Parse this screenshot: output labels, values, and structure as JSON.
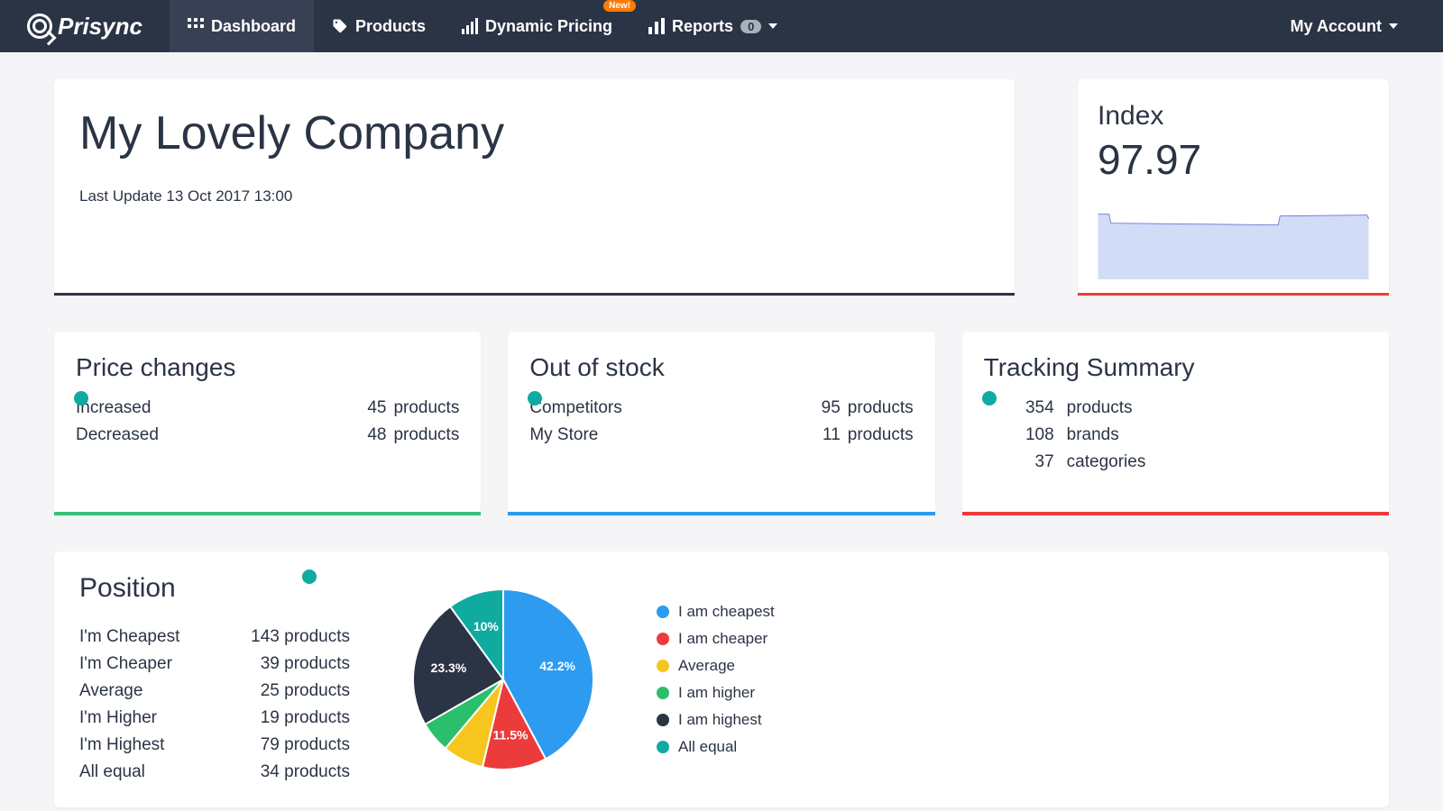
{
  "brand": "Prisync",
  "nav": {
    "dashboard": "Dashboard",
    "products": "Products",
    "dynamic": "Dynamic Pricing",
    "new_badge": "New!",
    "reports": "Reports",
    "reports_count": "0",
    "account": "My Account"
  },
  "title_card": {
    "company": "My Lovely Company",
    "updated": "Last Update 13 Oct 2017 13:00"
  },
  "index_card": {
    "title": "Index",
    "value": "97.97"
  },
  "price_changes": {
    "title": "Price changes",
    "rows": [
      {
        "label": "Increased",
        "count": "45",
        "unit": "products"
      },
      {
        "label": "Decreased",
        "count": "48",
        "unit": "products"
      }
    ]
  },
  "out_of_stock": {
    "title": "Out of stock",
    "rows": [
      {
        "label": "Competitors",
        "count": "95",
        "unit": "products"
      },
      {
        "label": "My Store",
        "count": "11",
        "unit": "products"
      }
    ]
  },
  "tracking": {
    "title": "Tracking Summary",
    "rows": [
      {
        "count": "354",
        "label": "products"
      },
      {
        "count": "108",
        "label": "brands"
      },
      {
        "count": "37",
        "label": "categories"
      }
    ]
  },
  "position": {
    "title": "Position",
    "rows": [
      {
        "label": "I'm Cheapest",
        "count": "143",
        "unit": "products"
      },
      {
        "label": "I'm Cheaper",
        "count": "39",
        "unit": "products"
      },
      {
        "label": "Average",
        "count": "25",
        "unit": "products"
      },
      {
        "label": "I'm Higher",
        "count": "19",
        "unit": "products"
      },
      {
        "label": "I'm Highest",
        "count": "79",
        "unit": "products"
      },
      {
        "label": "All equal",
        "count": "34",
        "unit": "products"
      }
    ]
  },
  "legend": [
    {
      "color": "#2d9bf0",
      "label": "I am cheapest"
    },
    {
      "color": "#ec3b3b",
      "label": "I am cheaper"
    },
    {
      "color": "#f6c61f",
      "label": "Average"
    },
    {
      "color": "#2bbf6b",
      "label": "I am higher"
    },
    {
      "color": "#2b3445",
      "label": "I am highest"
    },
    {
      "color": "#0faaa0",
      "label": "All equal"
    }
  ],
  "chart_data": {
    "type": "pie",
    "title": "Position",
    "slices": [
      {
        "label": "I am cheapest",
        "value": 42.2,
        "color": "#2d9bf0",
        "text": "42.2%"
      },
      {
        "label": "I am cheaper",
        "value": 11.5,
        "color": "#ec3b3b",
        "text": "11.5%"
      },
      {
        "label": "Average",
        "value": 7.4,
        "color": "#f6c61f",
        "text": ""
      },
      {
        "label": "I am higher",
        "value": 5.6,
        "color": "#2bbf6b",
        "text": ""
      },
      {
        "label": "I am highest",
        "value": 23.3,
        "color": "#2b3445",
        "text": "23.3%"
      },
      {
        "label": "All equal",
        "value": 10.0,
        "color": "#0faaa0",
        "text": "10%"
      }
    ]
  }
}
